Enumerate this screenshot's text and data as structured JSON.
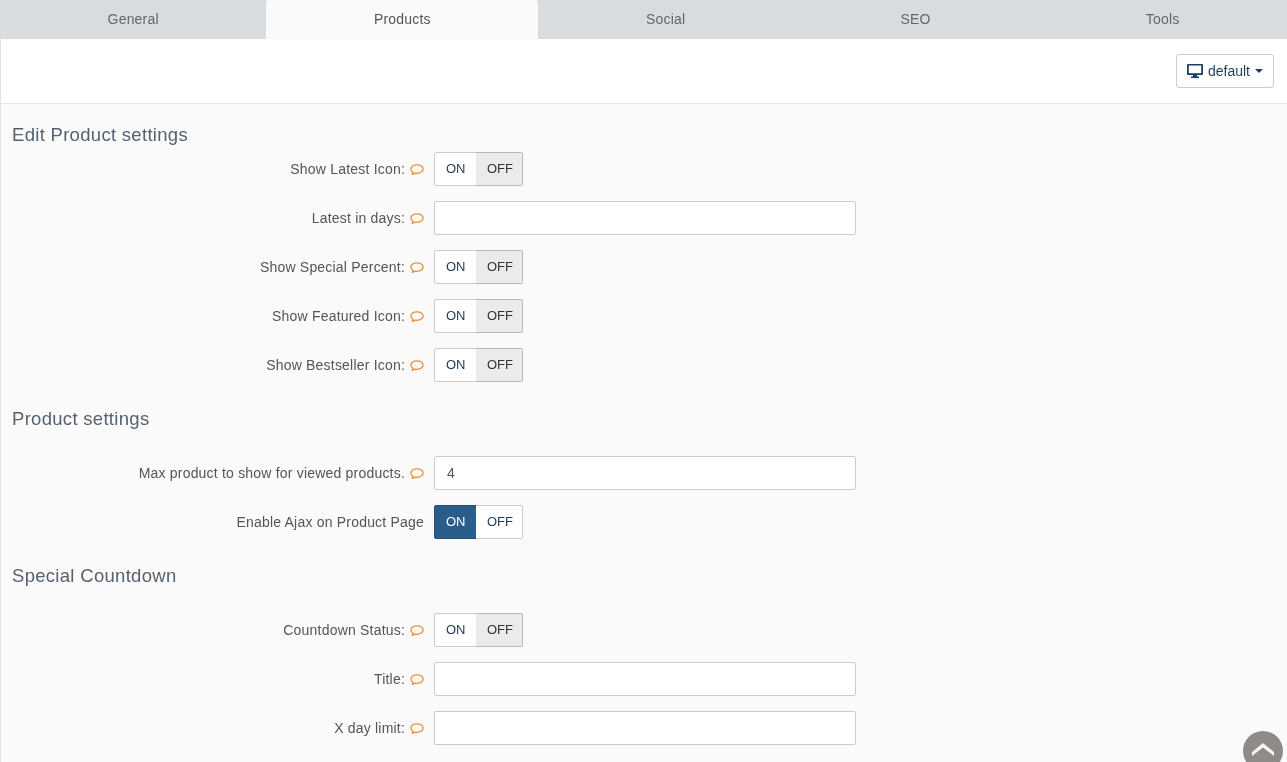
{
  "tabs": [
    {
      "label": "General",
      "selected": false
    },
    {
      "label": "Products",
      "selected": true
    },
    {
      "label": "Social",
      "selected": false
    },
    {
      "label": "SEO",
      "selected": false
    },
    {
      "label": "Tools",
      "selected": false
    }
  ],
  "device_menu": {
    "label": "default"
  },
  "sections": [
    {
      "title": "Edit Product settings",
      "fields": [
        {
          "kind": "switch",
          "label": "Show Latest Icon:",
          "help": true,
          "on_text": "ON",
          "off_text": "OFF",
          "on": false
        },
        {
          "kind": "text",
          "label": "Latest in days:",
          "help": true
        },
        {
          "kind": "switch",
          "label": "Show Special Percent:",
          "help": true,
          "on_text": "ON",
          "off_text": "OFF",
          "on": false
        },
        {
          "kind": "switch",
          "label": "Show Featured Icon:",
          "help": true,
          "on_text": "ON",
          "off_text": "OFF",
          "on": false
        },
        {
          "kind": "switch",
          "label": "Show Bestseller Icon:",
          "help": true,
          "on_text": "ON",
          "off_text": "OFF",
          "on": false
        }
      ]
    },
    {
      "title": "Product settings",
      "fields": [
        {
          "kind": "text",
          "label": "Max product to show for viewed products.",
          "help": true,
          "value": "4"
        },
        {
          "kind": "switch",
          "label": "Enable Ajax on Product Page",
          "help": false,
          "on_text": "ON",
          "off_text": "OFF",
          "on": true
        }
      ]
    },
    {
      "title": "Special Countdown",
      "fields": [
        {
          "kind": "switch",
          "label": "Countdown Status:",
          "help": true,
          "on_text": "ON",
          "off_text": "OFF",
          "on": false
        },
        {
          "kind": "text",
          "label": "Title:",
          "help": true
        },
        {
          "kind": "text",
          "label": "X day limit:",
          "help": true
        }
      ]
    }
  ]
}
